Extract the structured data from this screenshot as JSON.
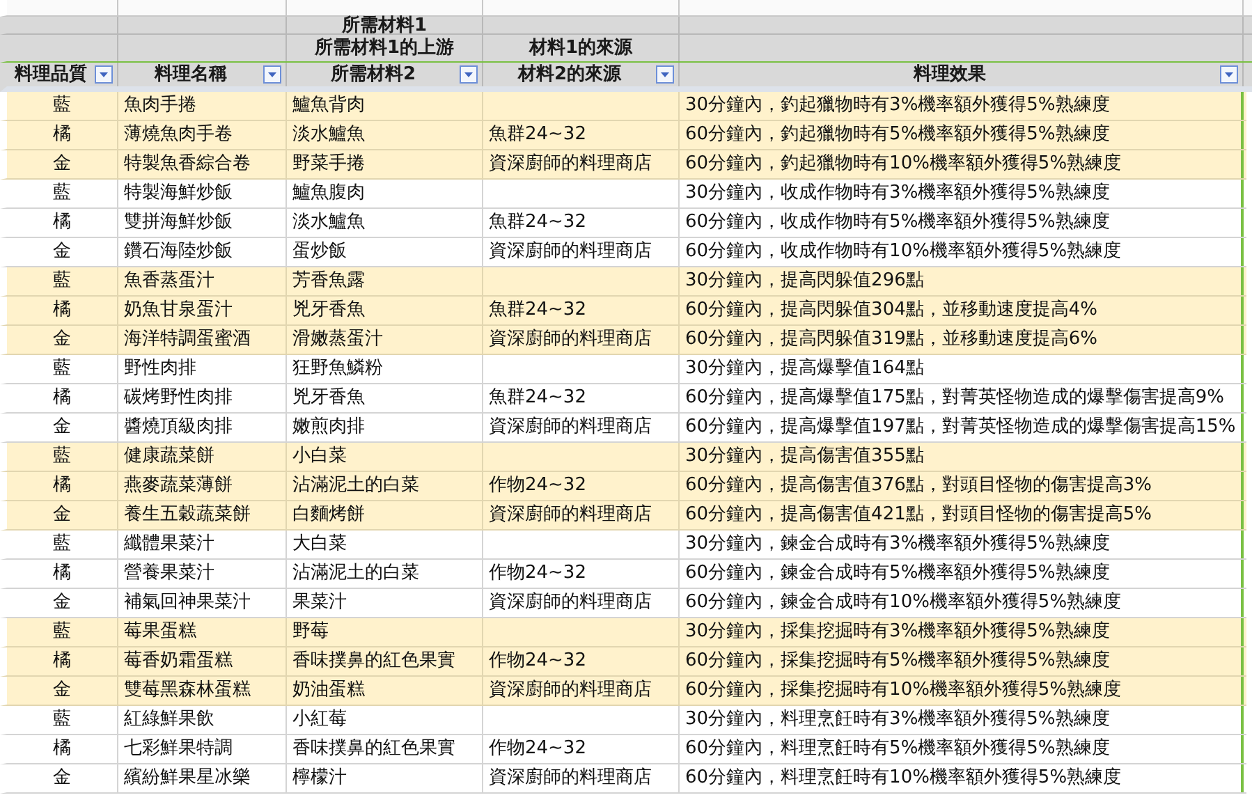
{
  "columns": [
    {
      "label": "料理品質"
    },
    {
      "label": "料理名稱"
    },
    {
      "label": "所需材料2",
      "group": "所需材料1",
      "upper": "所需材料1的上游"
    },
    {
      "label": "材料2的來源",
      "upper": "材料1的來源"
    },
    {
      "label": "料理效果"
    }
  ],
  "rows": [
    {
      "quality": "藍",
      "name": "魚肉手捲",
      "material": "鱸魚背肉",
      "effect": "30分鐘內，釣起獵物時有3%機率額外獲得5%熟練度",
      "highlighted": true
    },
    {
      "quality": "橘",
      "name": "薄燒魚肉手卷",
      "material": "淡水鱸魚",
      "source": "魚群24~32",
      "effect": "60分鐘內，釣起獵物時有5%機率額外獲得5%熟練度",
      "highlighted": true
    },
    {
      "quality": "金",
      "name": "特製魚香綜合卷",
      "material": "野菜手捲",
      "source": "資深廚師的料理商店",
      "effect": "60分鐘內，釣起獵物時有10%機率額外獲得5%熟練度",
      "highlighted": true
    },
    {
      "quality": "藍",
      "name": "特製海鮮炒飯",
      "material": "鱸魚腹肉",
      "effect": "30分鐘內，收成作物時有3%機率額外獲得5%熟練度",
      "highlighted": false
    },
    {
      "quality": "橘",
      "name": "雙拼海鮮炒飯",
      "material": "淡水鱸魚",
      "source": "魚群24~32",
      "effect": "60分鐘內，收成作物時有5%機率額外獲得5%熟練度",
      "highlighted": false
    },
    {
      "quality": "金",
      "name": "鑽石海陸炒飯",
      "material": "蛋炒飯",
      "source": "資深廚師的料理商店",
      "effect": "60分鐘內，收成作物時有10%機率額外獲得5%熟練度",
      "highlighted": false
    },
    {
      "quality": "藍",
      "name": "魚香蒸蛋汁",
      "material": "芳香魚露",
      "effect": "30分鐘內，提高閃躲值296點",
      "highlighted": true
    },
    {
      "quality": "橘",
      "name": "奶魚甘泉蛋汁",
      "material": "兇牙香魚",
      "source": "魚群24~32",
      "effect": "60分鐘內，提高閃躲值304點，並移動速度提高4%",
      "highlighted": true
    },
    {
      "quality": "金",
      "name": "海洋特調蛋蜜酒",
      "material": "滑嫩蒸蛋汁",
      "source": "資深廚師的料理商店",
      "effect": "60分鐘內，提高閃躲值319點，並移動速度提高6%",
      "highlighted": true
    },
    {
      "quality": "藍",
      "name": "野性肉排",
      "material": "狂野魚鱗粉",
      "effect": "30分鐘內，提高爆擊值164點",
      "highlighted": false
    },
    {
      "quality": "橘",
      "name": "碳烤野性肉排",
      "material": "兇牙香魚",
      "source": "魚群24~32",
      "effect": "60分鐘內，提高爆擊值175點，對菁英怪物造成的爆擊傷害提高9%",
      "highlighted": false
    },
    {
      "quality": "金",
      "name": "醬燒頂級肉排",
      "material": "嫩煎肉排",
      "source": "資深廚師的料理商店",
      "effect": "60分鐘內，提高爆擊值197點，對菁英怪物造成的爆擊傷害提高15%",
      "highlighted": false
    },
    {
      "quality": "藍",
      "name": "健康蔬菜餅",
      "material": "小白菜",
      "effect": "30分鐘內，提高傷害值355點",
      "highlighted": true
    },
    {
      "quality": "橘",
      "name": "燕麥蔬菜薄餅",
      "material": "沾滿泥土的白菜",
      "source": "作物24~32",
      "effect": "60分鐘內，提高傷害值376點，對頭目怪物的傷害提高3%",
      "highlighted": true
    },
    {
      "quality": "金",
      "name": "養生五穀蔬菜餅",
      "material": "白麵烤餅",
      "source": "資深廚師的料理商店",
      "effect": "60分鐘內，提高傷害值421點，對頭目怪物的傷害提高5%",
      "highlighted": true
    },
    {
      "quality": "藍",
      "name": "纖體果菜汁",
      "material": "大白菜",
      "effect": "30分鐘內，鍊金合成時有3%機率額外獲得5%熟練度",
      "highlighted": false
    },
    {
      "quality": "橘",
      "name": "營養果菜汁",
      "material": "沾滿泥土的白菜",
      "source": "作物24~32",
      "effect": "60分鐘內，鍊金合成時有5%機率額外獲得5%熟練度",
      "highlighted": false
    },
    {
      "quality": "金",
      "name": "補氣回神果菜汁",
      "material": "果菜汁",
      "source": "資深廚師的料理商店",
      "effect": "60分鐘內，鍊金合成時有10%機率額外獲得5%熟練度",
      "highlighted": false
    },
    {
      "quality": "藍",
      "name": "莓果蛋糕",
      "material": "野莓",
      "effect": "30分鐘內，採集挖掘時有3%機率額外獲得5%熟練度",
      "highlighted": true
    },
    {
      "quality": "橘",
      "name": "莓香奶霜蛋糕",
      "material": "香味撲鼻的紅色果實",
      "source": "作物24~32",
      "effect": "60分鐘內，採集挖掘時有5%機率額外獲得5%熟練度",
      "highlighted": true
    },
    {
      "quality": "金",
      "name": "雙莓黑森林蛋糕",
      "material": "奶油蛋糕",
      "source": "資深廚師的料理商店",
      "effect": "60分鐘內，採集挖掘時有10%機率額外獲得5%熟練度",
      "highlighted": true
    },
    {
      "quality": "藍",
      "name": "紅綠鮮果飲",
      "material": "小紅莓",
      "effect": "30分鐘內，料理烹飪時有3%機率額外獲得5%熟練度",
      "highlighted": false
    },
    {
      "quality": "橘",
      "name": "七彩鮮果特調",
      "material": "香味撲鼻的紅色果實",
      "source": "作物24~32",
      "effect": "60分鐘內，料理烹飪時有5%機率額外獲得5%熟練度",
      "highlighted": false
    },
    {
      "quality": "金",
      "name": "繽紛鮮果星冰樂",
      "material": "檸檬汁",
      "source": "資深廚師的料理商店",
      "effect": "60分鐘內，料理烹飪時有10%機率額外獲得5%熟練度",
      "highlighted": false
    }
  ]
}
